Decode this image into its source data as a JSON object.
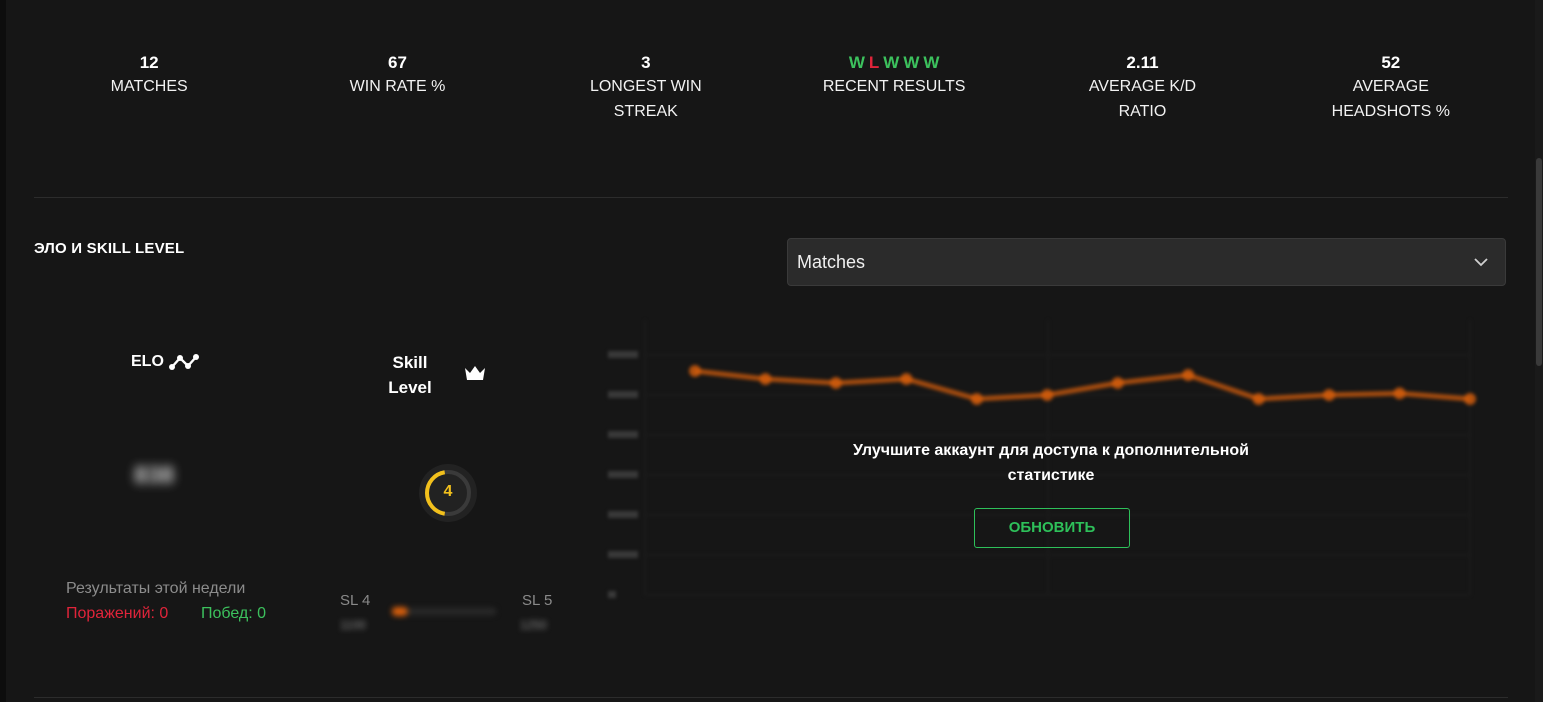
{
  "stats": [
    {
      "value": "12",
      "label": "MATCHES"
    },
    {
      "value": "67",
      "label": "WIN RATE %"
    },
    {
      "value": "3",
      "label": "LONGEST WIN STREAK"
    },
    {
      "value": "",
      "label": "RECENT RESULTS"
    },
    {
      "value": "2.11",
      "label": "AVERAGE K/D RATIO"
    },
    {
      "value": "52",
      "label": "AVERAGE HEADSHOTS %"
    }
  ],
  "recent_results": [
    "W",
    "L",
    "W",
    "W",
    "W"
  ],
  "colors": {
    "win": "#3cc15d",
    "loss": "#e0243a",
    "accent": "#2ec05a",
    "skill": "#f2c01c",
    "chart_line": "#d85f0c"
  },
  "section": {
    "title": "ЭЛО И SKILL LEVEL"
  },
  "dropdown": {
    "selected": "Matches"
  },
  "elo": {
    "label": "ELO",
    "value": "838",
    "icon": "elo-graph-icon"
  },
  "skill": {
    "label_line1": "Skill",
    "label_line2": "Level",
    "level": "4",
    "icon": "crown-icon",
    "progress": 0.45
  },
  "week": {
    "title": "Результаты этой недели",
    "losses": "Поражений: 0",
    "wins": "Побед: 0"
  },
  "skill_range": {
    "from_label": "SL 4",
    "from_elo": "1100",
    "to_label": "SL 5",
    "to_elo": "1250",
    "progress": 0.15
  },
  "upgrade": {
    "message": "Улучшите аккаунт для доступа к дополнительной статистике",
    "button": "ОБНОВИТЬ"
  },
  "chart_data": {
    "type": "line",
    "x": [
      1,
      2,
      3,
      4,
      5,
      6,
      7,
      8,
      9,
      10,
      11,
      12
    ],
    "values": [
      1180,
      1170,
      1165,
      1170,
      1145,
      1150,
      1165,
      1175,
      1145,
      1150,
      1152,
      1145
    ]
  }
}
